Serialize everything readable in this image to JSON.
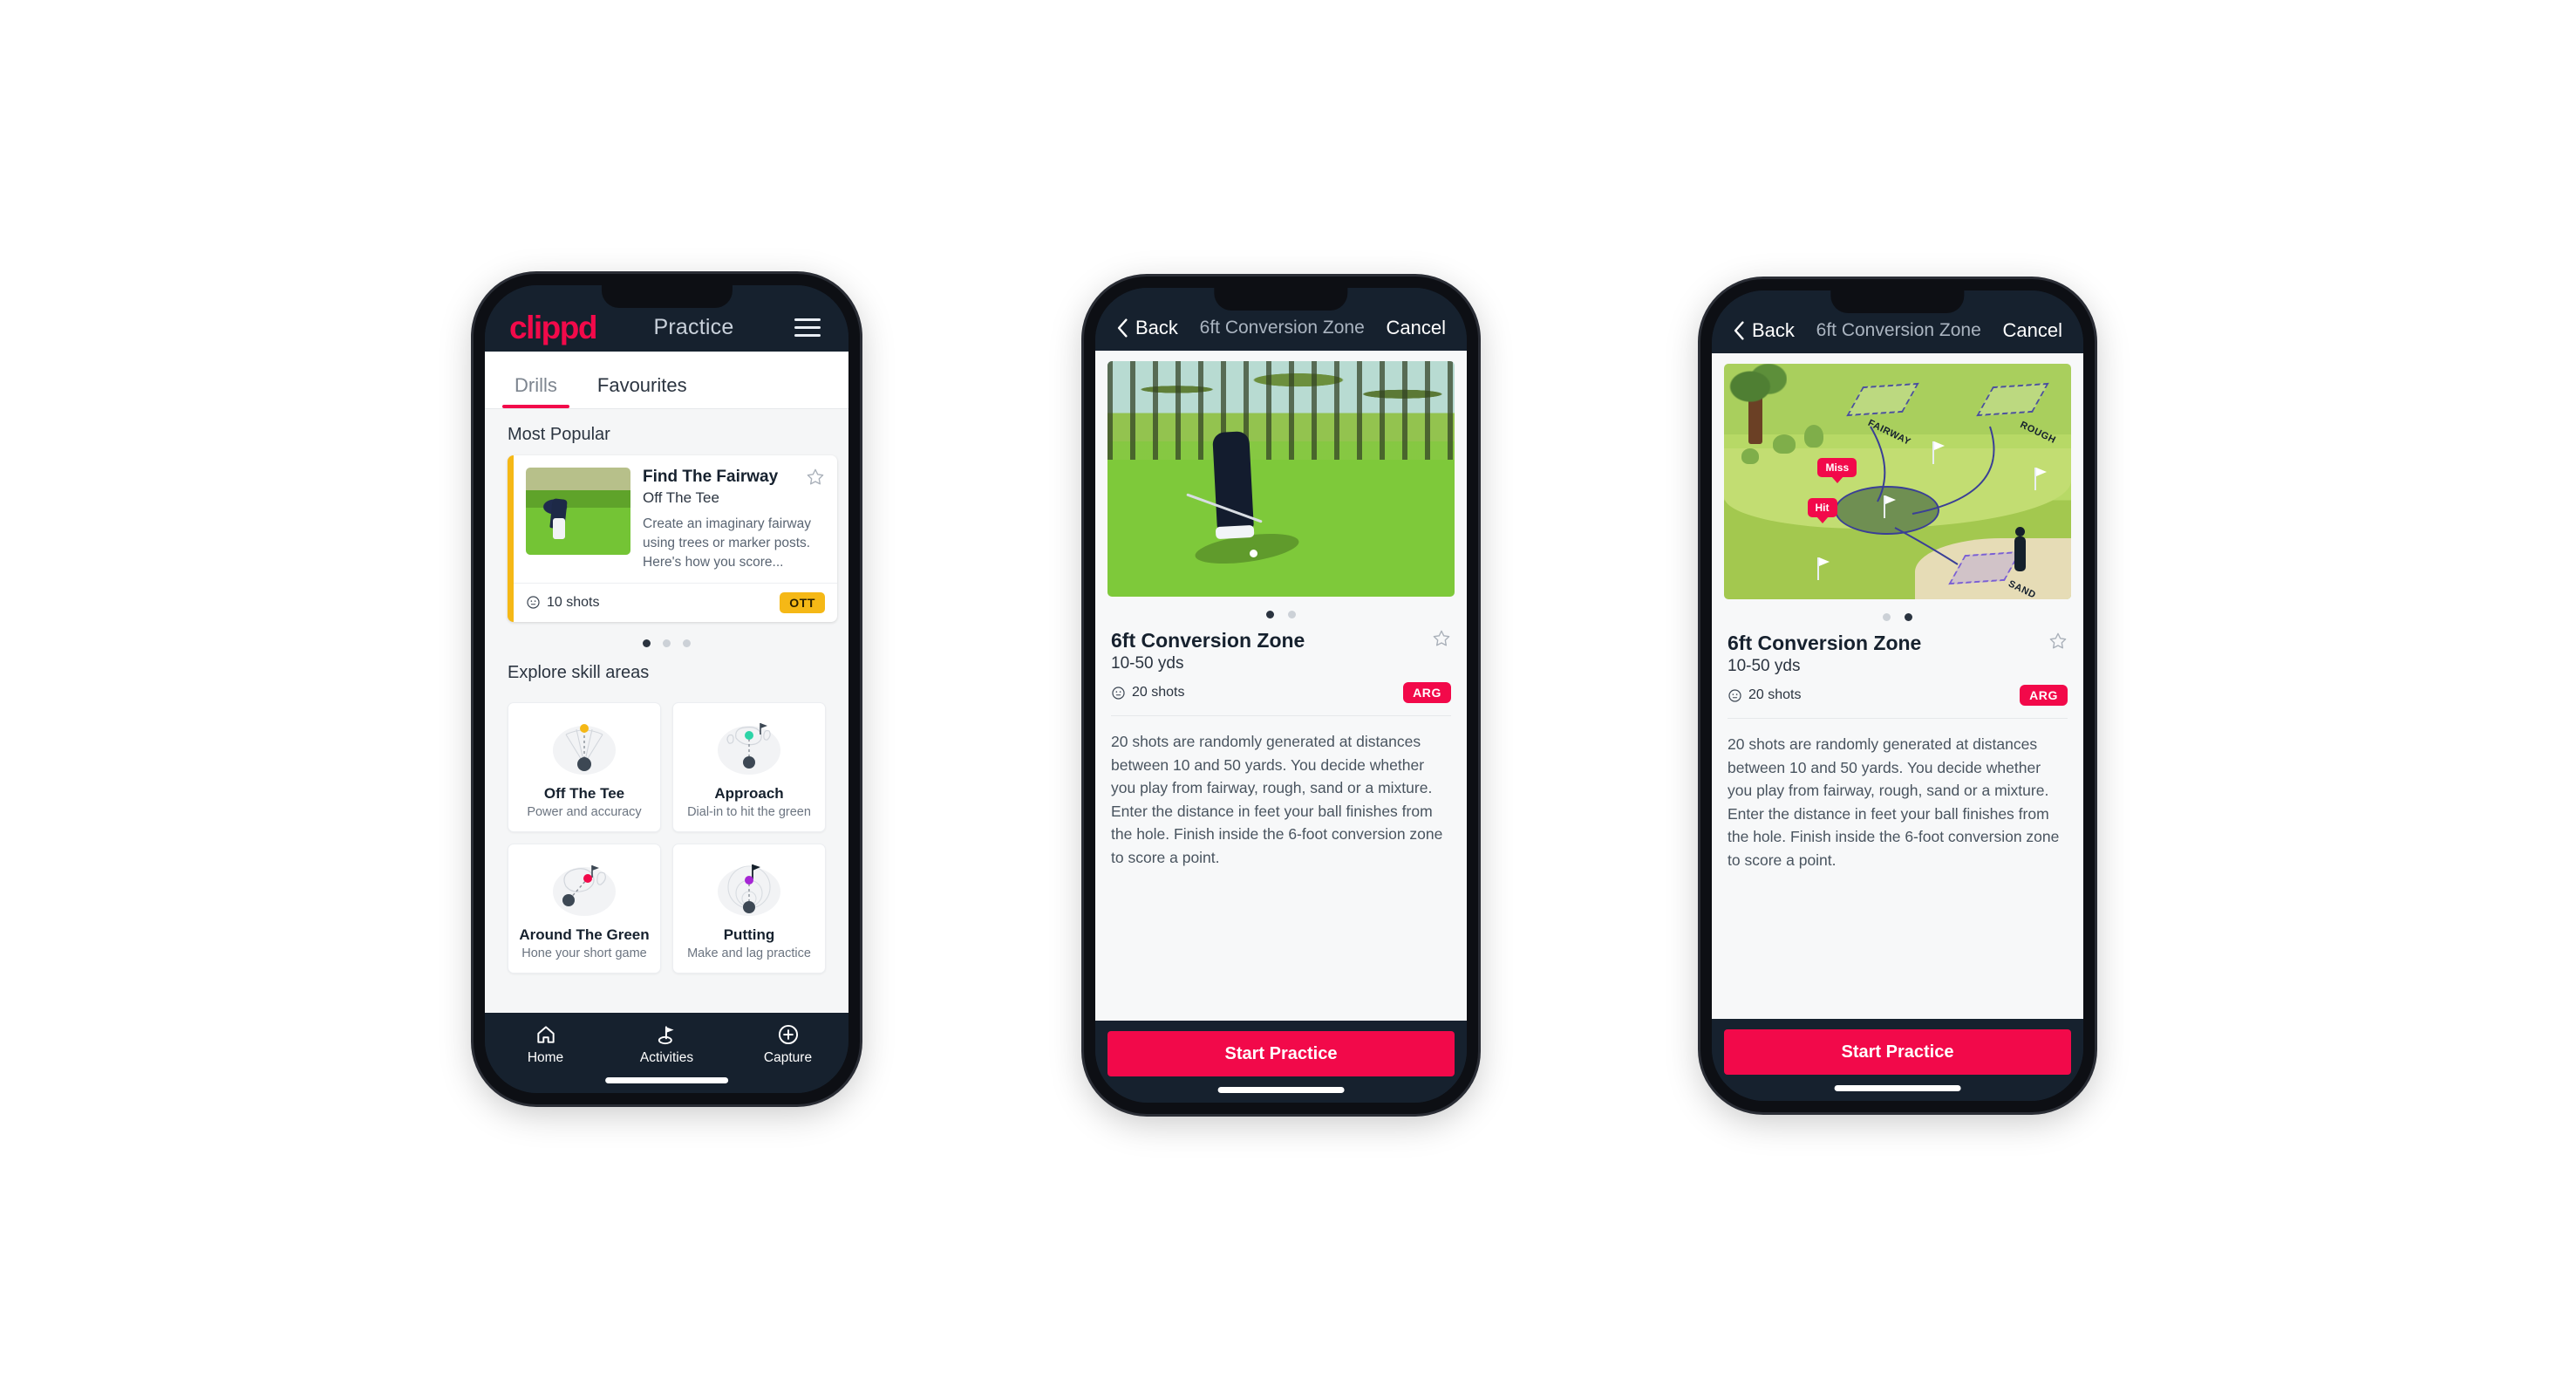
{
  "phone1": {
    "header": {
      "logo": "clippd",
      "title": "Practice",
      "menu_icon": "hamburger-icon"
    },
    "tabs": [
      {
        "label": "Drills",
        "active": true
      },
      {
        "label": "Favourites",
        "active": false
      }
    ],
    "sections": {
      "most_popular_label": "Most Popular",
      "explore_label": "Explore skill areas"
    },
    "drill_card": {
      "title": "Find The Fairway",
      "subtitle": "Off The Tee",
      "description": "Create an imaginary fairway using trees or marker posts. Here's how you score...",
      "shots": "10 shots",
      "badge": "OTT",
      "badge_color": "#F5B816",
      "favourite_icon": "star-outline-icon"
    },
    "carousel_dots": {
      "count": 3,
      "active_index": 0
    },
    "skill_areas": [
      {
        "name": "Off The Tee",
        "desc": "Power and accuracy",
        "icon": "tee-fan-icon",
        "accent": "#F5B816"
      },
      {
        "name": "Approach",
        "desc": "Dial-in to hit the green",
        "icon": "approach-green-icon",
        "accent": "#2DD4A7"
      },
      {
        "name": "Around The Green",
        "desc": "Hone your short game",
        "icon": "chip-green-icon",
        "accent": "#F2094A"
      },
      {
        "name": "Putting",
        "desc": "Make and lag practice",
        "icon": "putting-rings-icon",
        "accent": "#A626D4"
      }
    ],
    "nav": [
      {
        "label": "Home",
        "icon": "home-icon",
        "active": false
      },
      {
        "label": "Activities",
        "icon": "flag-golf-icon",
        "active": true
      },
      {
        "label": "Capture",
        "icon": "plus-circle-icon",
        "active": false
      }
    ]
  },
  "detail": {
    "header": {
      "back_label": "Back",
      "back_icon": "chevron-left-icon",
      "title": "6ft Conversion Zone",
      "cancel_label": "Cancel"
    },
    "name": "6ft Conversion Zone",
    "yards": "10-50 yds",
    "shots": "20 shots",
    "badge": "ARG",
    "badge_color": "#F2094A",
    "favourite_icon": "star-outline-icon",
    "description": "20 shots are randomly generated at distances between 10 and 50 yards. You decide whether you play from fairway, rough, sand or a mixture. Enter the distance in feet your ball finishes from the hole. Finish inside the 6-foot conversion zone to score a point.",
    "start_label": "Start Practice"
  },
  "phone2": {
    "media_type": "video-thumbnail",
    "media_alt": "golfer-chipping-photo",
    "dots": {
      "count": 2,
      "active_index": 0
    }
  },
  "phone3": {
    "media_type": "course-illustration",
    "media_alt": "golf-course-diagram",
    "dots": {
      "count": 2,
      "active_index": 1
    },
    "map_labels": {
      "fairway": "FAIRWAY",
      "rough": "ROUGH",
      "sand": "SAND",
      "miss": "Miss",
      "hit": "Hit"
    }
  },
  "theme": {
    "brand_pink": "#F2094A",
    "dark_navy": "#16212e",
    "amber": "#F5B816",
    "teal": "#43DCB6"
  }
}
